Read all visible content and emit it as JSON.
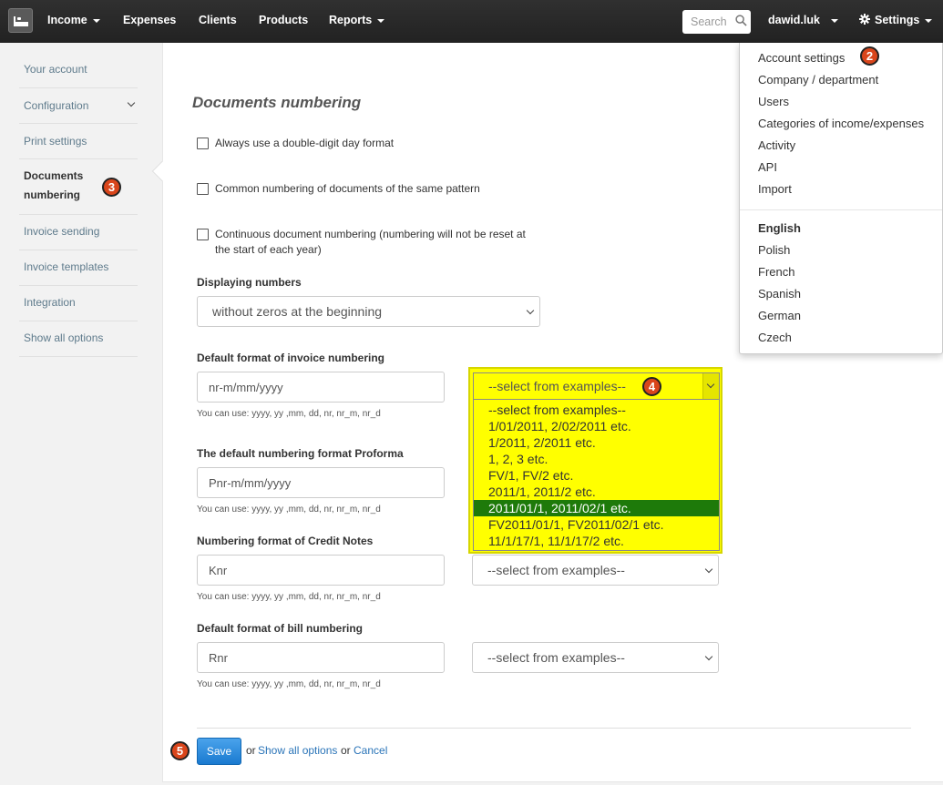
{
  "nav": {
    "items": [
      {
        "label": "Income",
        "dropdown": true
      },
      {
        "label": "Expenses",
        "dropdown": false
      },
      {
        "label": "Clients",
        "dropdown": false
      },
      {
        "label": "Products",
        "dropdown": false
      },
      {
        "label": "Reports",
        "dropdown": true
      }
    ],
    "search_placeholder": "Search",
    "user": "dawid.luk",
    "settings_label": "Settings"
  },
  "sidebar": {
    "items": [
      {
        "label": "Your account"
      },
      {
        "label": "Configuration"
      },
      {
        "label": "Print settings"
      },
      {
        "label": "Documents numbering",
        "label_line1": "Documents",
        "label_line2": "numbering",
        "active": true
      },
      {
        "label": "Invoice sending"
      },
      {
        "label": "Invoice templates"
      },
      {
        "label": "Integration"
      },
      {
        "label": "Show all options"
      }
    ]
  },
  "main": {
    "title": "Documents numbering",
    "checkboxes": [
      {
        "label": "Always use a double-digit day format",
        "checked": false
      },
      {
        "label": "Common numbering of documents of the same pattern",
        "checked": false
      },
      {
        "label": "Continuous document numbering (numbering will not be reset at the start of each year)",
        "checked": false
      }
    ],
    "displaying_numbers": {
      "label": "Displaying numbers",
      "value": "without zeros at the beginning"
    },
    "formats": [
      {
        "label": "Default format of invoice numbering",
        "value": "nr-m/mm/yyyy",
        "help": "You can use: yyyy, yy ,mm, dd, nr, nr_m, nr_d",
        "select": "--select from examples--"
      },
      {
        "label": "The default numbering format Proforma",
        "value": "Pnr-m/mm/yyyy",
        "help": "You can use: yyyy, yy ,mm, dd, nr, nr_m, nr_d"
      },
      {
        "label": "Numbering format of Credit Notes",
        "value": "Knr",
        "help": "You can use: yyyy, yy ,mm, dd, nr, nr_m, nr_d",
        "select": "--select from examples--"
      },
      {
        "label": "Default format of bill numbering",
        "value": "Rnr",
        "help": "You can use: yyyy, yy ,mm, dd, nr, nr_m, nr_d",
        "select": "--select from examples--"
      }
    ],
    "open_select": {
      "value": "--select from examples--",
      "options": [
        "--select from examples--",
        "1/01/2011, 2/02/2011 etc.",
        "1/2011, 2/2011 etc.",
        "1, 2, 3 etc.",
        "FV/1, FV/2 etc.",
        "2011/1, 2011/2 etc.",
        "2011/01/1, 2011/02/1 etc.",
        "FV2011/01/1, FV2011/02/1 etc.",
        "11/1/17/1, 11/1/17/2 etc."
      ],
      "highlighted_index": 6,
      "highlight_color": "#ffff00",
      "selected_color": "#1e7a0a"
    },
    "footer": {
      "save_label": "Save",
      "or1": "or",
      "show_all_label": "Show all options",
      "or2": "or",
      "cancel_label": "Cancel"
    }
  },
  "settings_menu": {
    "items": [
      "Account settings",
      "Company / department",
      "Users",
      "Categories of income/expenses",
      "Activity",
      "API",
      "Import"
    ],
    "languages": [
      "English",
      "Polish",
      "French",
      "Spanish",
      "German",
      "Czech"
    ],
    "active_language": "English"
  },
  "badges": [
    "2",
    "3",
    "4",
    "5"
  ],
  "colors": {
    "navbar": "#2a2a2a",
    "link": "#2a74b8",
    "sidebar_link": "#5f7b8c",
    "badge": "#d9451b",
    "save_button": "#1a7ad0"
  }
}
